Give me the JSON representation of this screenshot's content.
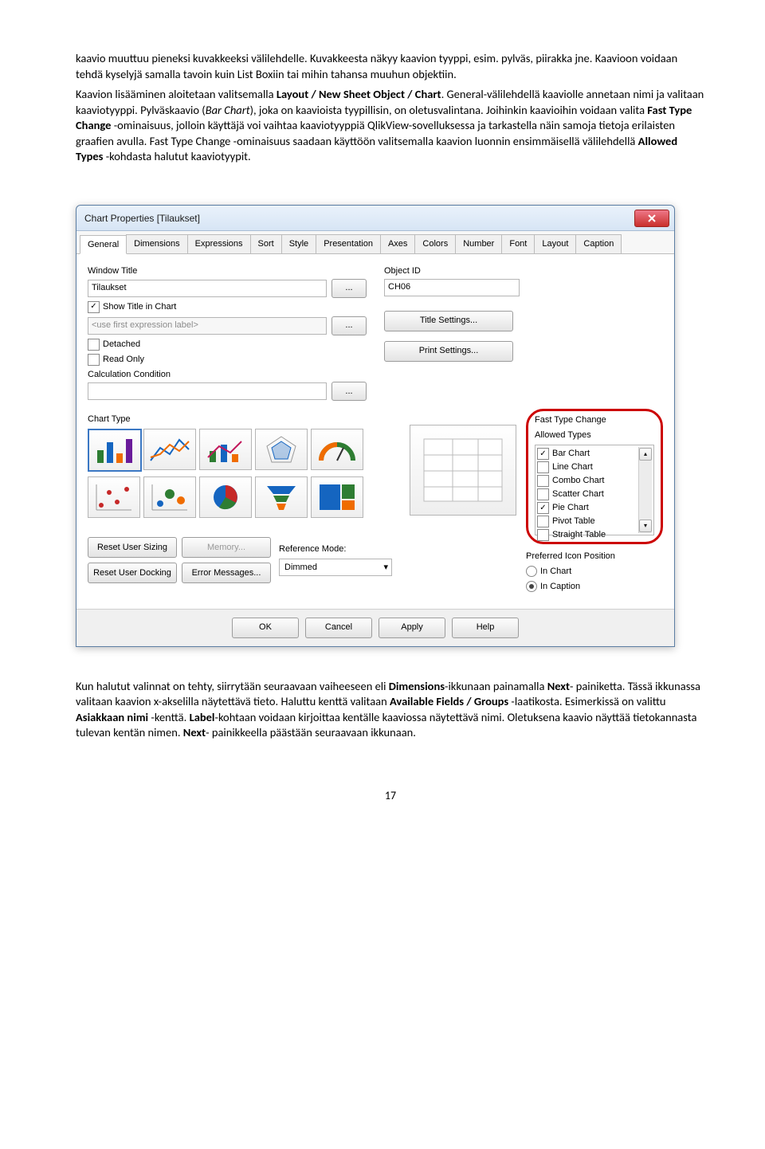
{
  "para1": "kaavio muuttuu pieneksi kuvakkeeksi välilehdelle. Kuvakkeesta näkyy kaavion tyyppi, esim. pylväs, piirakka jne. Kaavioon voidaan tehdä kyselyjä samalla tavoin kuin List Boxiin tai mihin tahansa muuhun objektiin.",
  "para2_pre": "Kaavion lisääminen aloitetaan valitsemalla ",
  "para2_b1": "Layout / New Sheet Object / Chart",
  "para2_mid1": ". General-välilehdellä kaaviolle annetaan nimi ja valitaan kaaviotyyppi. Pylväskaavio (",
  "para2_i1": "Bar Chart",
  "para2_mid2": "), joka on kaavioista tyypillisin, on oletusvalintana. Joihinkin kaavioihin voidaan valita ",
  "para2_b2": "Fast Type Change",
  "para2_mid3": " -ominaisuus, jolloin käyttäjä voi vaihtaa kaaviotyyppiä QlikView-sovelluksessa ja tarkastella näin samoja tietoja erilaisten graafien avulla. Fast Type Change -ominaisuus saadaan käyttöön valitsemalla kaavion luonnin ensimmäisellä välilehdellä ",
  "para2_b3": "Allowed Types",
  "para2_end": " -kohdasta halutut kaaviotyypit.",
  "dialog": {
    "title": "Chart Properties [Tilaukset]",
    "close": "×",
    "tabs": [
      "General",
      "Dimensions",
      "Expressions",
      "Sort",
      "Style",
      "Presentation",
      "Axes",
      "Colors",
      "Number",
      "Font",
      "Layout",
      "Caption"
    ],
    "window_title_label": "Window Title",
    "window_title_value": "Tilaukset",
    "object_id_label": "Object ID",
    "object_id_value": "CH06",
    "show_title": "Show Title in Chart",
    "use_first_expr": "<use first expression label>",
    "title_settings": "Title Settings...",
    "detached": "Detached",
    "read_only": "Read Only",
    "print_settings": "Print Settings...",
    "calc_cond": "Calculation Condition",
    "chart_type_label": "Chart Type",
    "ftc_label": "Fast Type Change",
    "ftc_allowed": "Allowed Types",
    "ftc_items": [
      "Bar Chart",
      "Line Chart",
      "Combo Chart",
      "Scatter Chart",
      "Pie Chart",
      "Pivot Table",
      "Straight Table"
    ],
    "ftc_checked": {
      "Bar Chart": true,
      "Pie Chart": true
    },
    "pref_icon": "Preferred Icon Position",
    "in_chart": "In Chart",
    "in_caption": "In Caption",
    "reset_user_sizing": "Reset User Sizing",
    "memory": "Memory...",
    "reset_user_docking": "Reset User Docking",
    "error_messages": "Error Messages...",
    "reference_mode": "Reference Mode:",
    "reference_mode_value": "Dimmed",
    "ok": "OK",
    "cancel": "Cancel",
    "apply": "Apply",
    "help": "Help"
  },
  "para3_pre": "Kun halutut valinnat on tehty, siirrytään seuraavaan vaiheeseen eli ",
  "para3_b1": "Dimensions",
  "para3_mid1": "-ikkunaan painamalla ",
  "para3_b2": "Next",
  "para3_mid2": "- painiketta. Tässä ikkunassa valitaan kaavion x-akselilla näytettävä tieto. Haluttu kenttä valitaan ",
  "para3_b3": "Available Fields / Groups",
  "para3_mid3": " -laatikosta. Esimerkissä on valittu ",
  "para3_b4": "Asiakkaan nimi",
  "para3_mid4": " -kenttä. ",
  "para3_b5": "Label",
  "para3_mid5": "-kohtaan voidaan kirjoittaa kentälle kaaviossa näytettävä nimi. Oletuksena kaavio näyttää tietokannasta tulevan kentän nimen. ",
  "para3_b6": "Next",
  "para3_end": "- painikkeella päästään seuraavaan ikkunaan.",
  "page_number": "17"
}
